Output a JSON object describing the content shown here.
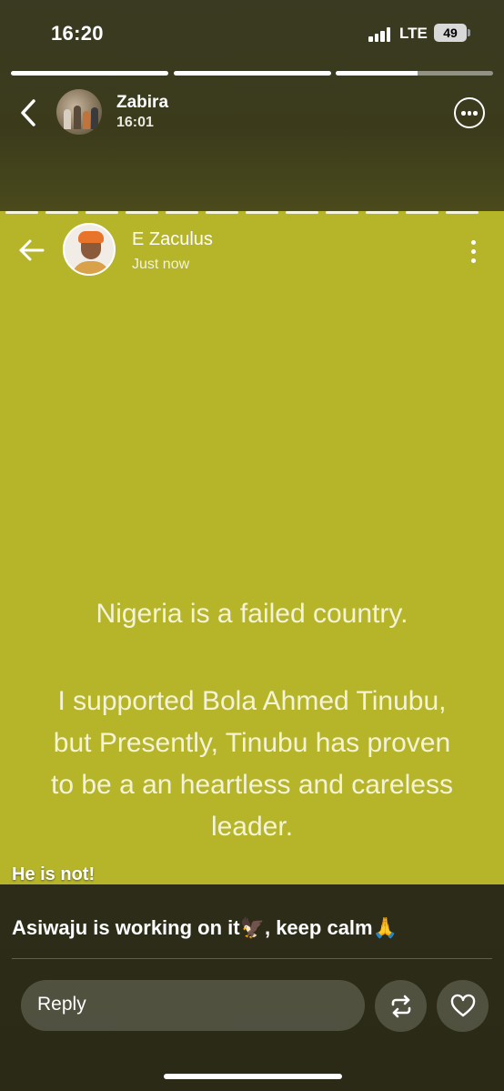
{
  "status_bar": {
    "time": "16:20",
    "network": "LTE",
    "battery": "49"
  },
  "story": {
    "progress_segments": [
      1,
      1,
      0.52
    ],
    "author": "Zabira",
    "posted_time": "16:01",
    "icons": {
      "back": "chevron-left-icon",
      "more": "ellipsis-circle-icon"
    }
  },
  "status_card": {
    "background": "#b6b52a",
    "author": "E Zaculus",
    "posted_time": "Just now",
    "lines": [
      "Nigeria is a failed country.",
      "I supported Bola Ahmed Tinubu,",
      "but Presently, Tinubu has proven",
      "to be a an heartless and careless",
      "leader."
    ],
    "icons": {
      "back": "arrow-left-icon",
      "more": "vertical-dots-icon"
    }
  },
  "caption": {
    "line1": "He is not!",
    "line2": "Asiwaju is working on it🦅, keep calm🙏"
  },
  "reply_bar": {
    "placeholder": "Reply",
    "icons": {
      "repost": "repost-icon",
      "like": "heart-icon"
    }
  }
}
